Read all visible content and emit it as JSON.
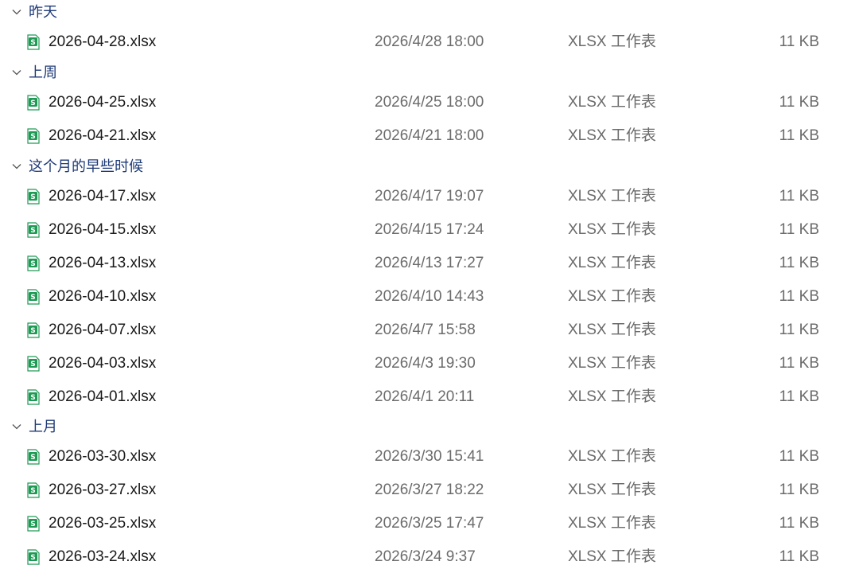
{
  "colors": {
    "group_title": "#1e3a78",
    "file_name": "#1a1a1a",
    "meta_text": "#6b6b6b",
    "icon_green": "#1e9a55"
  },
  "file_icon": "xlsx-spreadsheet-icon",
  "groups": [
    {
      "title": "昨天",
      "files": [
        {
          "name": "2026-04-28.xlsx",
          "date": "2026/4/28 18:00",
          "type": "XLSX 工作表",
          "size": "11 KB"
        }
      ]
    },
    {
      "title": "上周",
      "files": [
        {
          "name": "2026-04-25.xlsx",
          "date": "2026/4/25 18:00",
          "type": "XLSX 工作表",
          "size": "11 KB"
        },
        {
          "name": "2026-04-21.xlsx",
          "date": "2026/4/21 18:00",
          "type": "XLSX 工作表",
          "size": "11 KB"
        }
      ]
    },
    {
      "title": "这个月的早些时候",
      "files": [
        {
          "name": "2026-04-17.xlsx",
          "date": "2026/4/17 19:07",
          "type": "XLSX 工作表",
          "size": "11 KB"
        },
        {
          "name": "2026-04-15.xlsx",
          "date": "2026/4/15 17:24",
          "type": "XLSX 工作表",
          "size": "11 KB"
        },
        {
          "name": "2026-04-13.xlsx",
          "date": "2026/4/13 17:27",
          "type": "XLSX 工作表",
          "size": "11 KB"
        },
        {
          "name": "2026-04-10.xlsx",
          "date": "2026/4/10 14:43",
          "type": "XLSX 工作表",
          "size": "11 KB"
        },
        {
          "name": "2026-04-07.xlsx",
          "date": "2026/4/7 15:58",
          "type": "XLSX 工作表",
          "size": "11 KB"
        },
        {
          "name": "2026-04-03.xlsx",
          "date": "2026/4/3 19:30",
          "type": "XLSX 工作表",
          "size": "11 KB"
        },
        {
          "name": "2026-04-01.xlsx",
          "date": "2026/4/1 20:11",
          "type": "XLSX 工作表",
          "size": "11 KB"
        }
      ]
    },
    {
      "title": "上月",
      "files": [
        {
          "name": "2026-03-30.xlsx",
          "date": "2026/3/30 15:41",
          "type": "XLSX 工作表",
          "size": "11 KB"
        },
        {
          "name": "2026-03-27.xlsx",
          "date": "2026/3/27 18:22",
          "type": "XLSX 工作表",
          "size": "11 KB"
        },
        {
          "name": "2026-03-25.xlsx",
          "date": "2026/3/25 17:47",
          "type": "XLSX 工作表",
          "size": "11 KB"
        },
        {
          "name": "2026-03-24.xlsx",
          "date": "2026/3/24 9:37",
          "type": "XLSX 工作表",
          "size": "11 KB"
        }
      ]
    }
  ]
}
